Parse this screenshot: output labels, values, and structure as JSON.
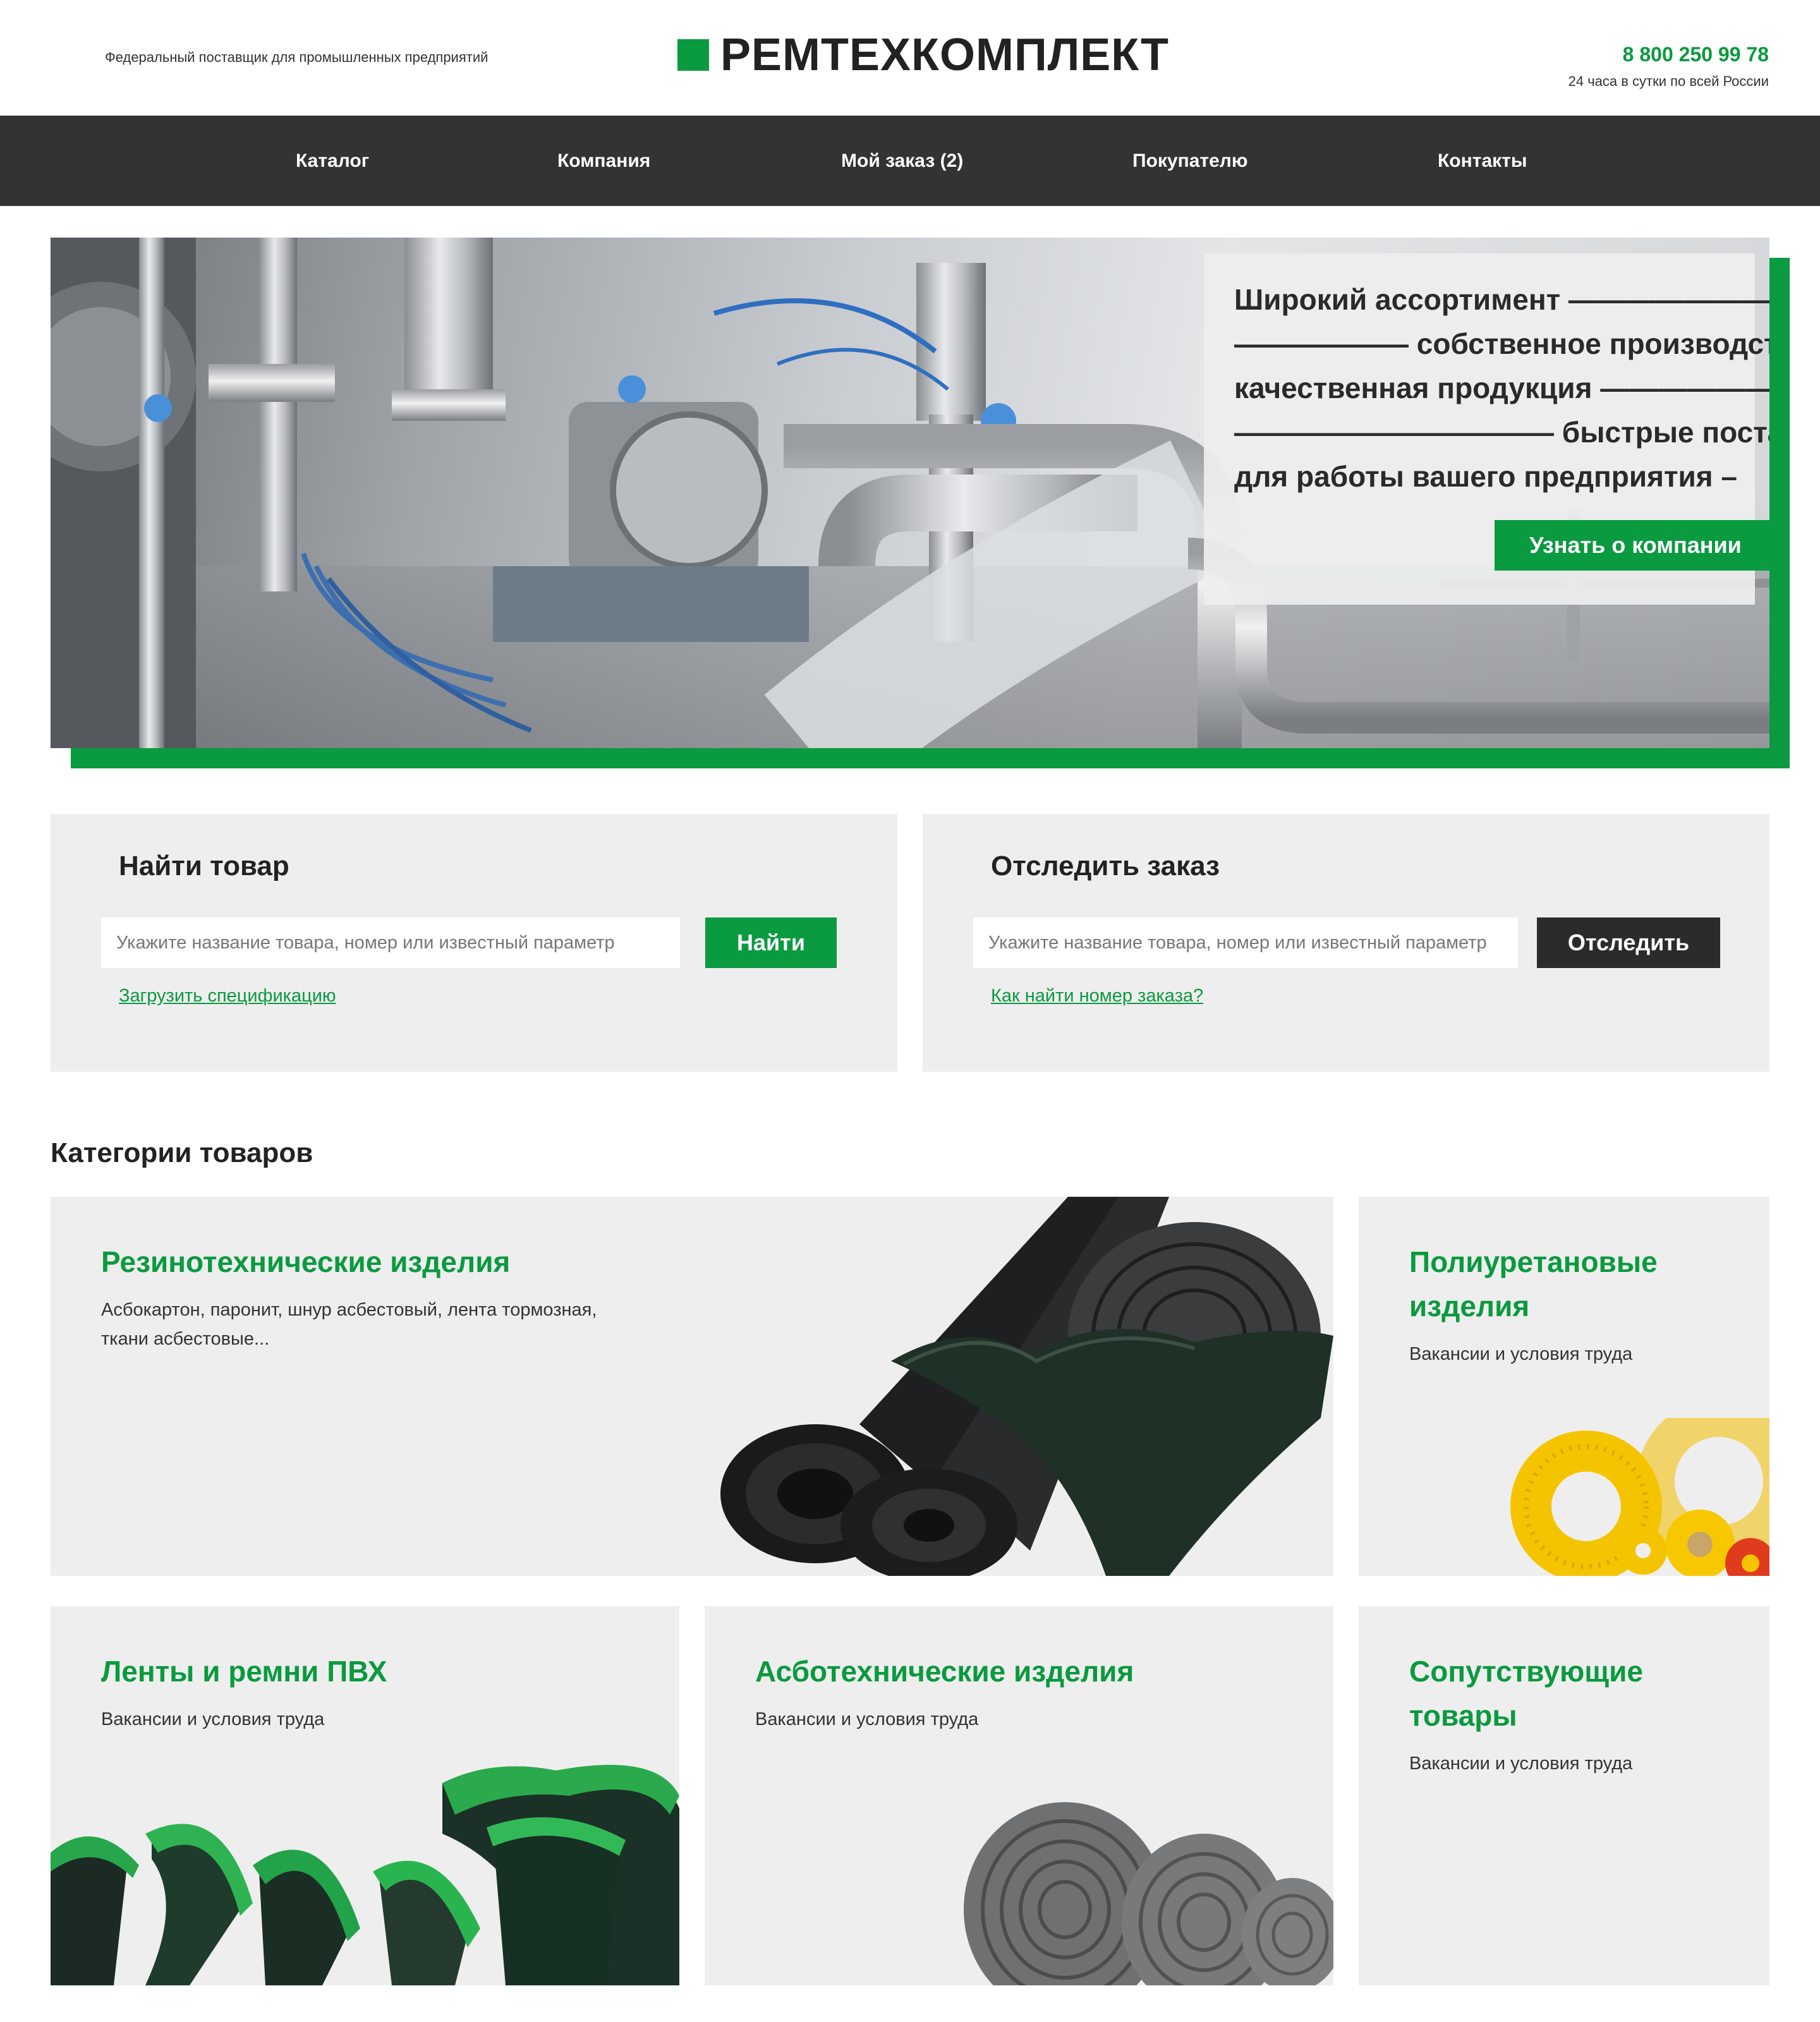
{
  "header": {
    "tagline": "Федеральный поставщик для промышленных предприятий",
    "logo_text": "РЕМТЕХКОМПЛЕКТ",
    "phone": "8 800 250 99 78",
    "phone_note": "24 часа в сутки по всей России"
  },
  "nav": {
    "items": [
      {
        "label": "Каталог"
      },
      {
        "label": "Компания"
      },
      {
        "label": "Мой заказ (2)"
      },
      {
        "label": "Покупателю"
      },
      {
        "label": "Контакты"
      }
    ]
  },
  "hero": {
    "lines": [
      "Широкий ассортимент —————————",
      "—————— собственное производство",
      "качественная продукция ————————",
      "——————————— быстрые поставки",
      "для работы вашего предприятия –"
    ],
    "button_label": "Узнать о компании"
  },
  "find_product": {
    "title": "Найти товар",
    "placeholder": "Укажите название товара, номер или известный параметр",
    "button_label": "Найти",
    "link_label": "Загрузить спецификацию"
  },
  "track_order": {
    "title": "Отследить заказ",
    "placeholder": "Укажите название товара, номер или известный параметр",
    "button_label": "Отследить",
    "link_label": "Как найти номер заказа?"
  },
  "categories": {
    "title": "Категории товаров",
    "items": [
      {
        "title": "Резинотехнические изделия",
        "desc_line1": "Асбокартон, паронит, шнур асбестовый, лента тормозная,",
        "desc_line2": "ткани асбестовые..."
      },
      {
        "title_line1": "Полиуретановые",
        "title_line2": "изделия",
        "desc": "Вакансии и условия труда"
      },
      {
        "title": "Ленты и ремни ПВХ",
        "desc": "Вакансии и условия труда"
      },
      {
        "title": "Асботехнические изделия",
        "desc": "Вакансии и условия труда"
      },
      {
        "title_line1": "Сопутствующие",
        "title_line2": "товары",
        "desc": "Вакансии и условия труда"
      }
    ]
  },
  "colors": {
    "accent": "#0a9a3f",
    "nav_bg": "#333333",
    "card_bg": "#efeeee",
    "dark_button": "#2b2b2b"
  }
}
